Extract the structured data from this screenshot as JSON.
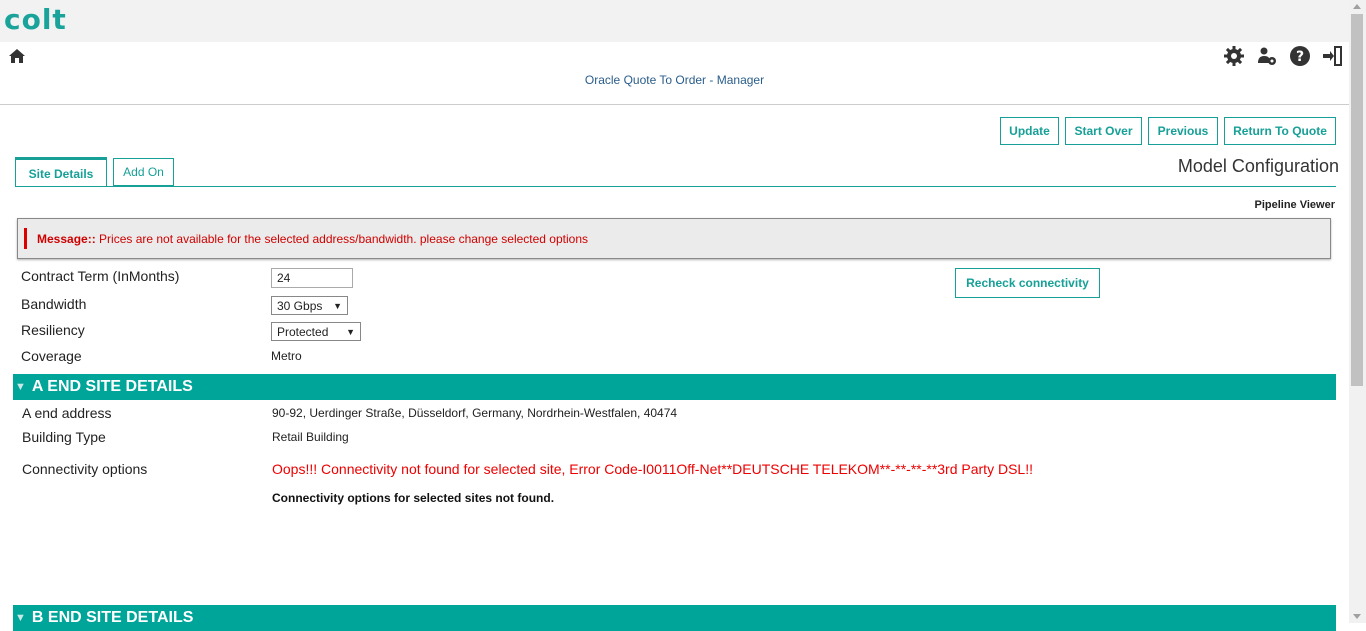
{
  "header": {
    "logo": "colt",
    "app_title": "Oracle Quote To Order - Manager",
    "icons": [
      "home-icon",
      "settings-gear-icon",
      "user-settings-icon",
      "help-icon",
      "logout-icon"
    ]
  },
  "toolbar": {
    "update": "Update",
    "start_over": "Start Over",
    "previous": "Previous",
    "return_to_quote": "Return To Quote"
  },
  "tabs": [
    {
      "label": "Site Details",
      "active": true
    },
    {
      "label": "Add On",
      "active": false
    }
  ],
  "model_config_title": "Model Configuration",
  "pipeline_viewer": "Pipeline Viewer",
  "message": {
    "prefix": "Message::",
    "text": " Prices are not available for the selected address/bandwidth. please change selected options"
  },
  "form": {
    "contract_term": {
      "label": "Contract Term (InMonths)",
      "value": "24"
    },
    "bandwidth": {
      "label": "Bandwidth",
      "value": "30 Gbps"
    },
    "resiliency": {
      "label": "Resiliency",
      "value": "Protected"
    },
    "coverage": {
      "label": "Coverage",
      "value": "Metro"
    },
    "recheck_button": "Recheck connectivity"
  },
  "a_end": {
    "section_title": "A END SITE DETAILS",
    "address_label": "A end address",
    "address_value": "90-92, Uerdinger Straße, Düsseldorf, Germany, Nordrhein-Westfalen, 40474",
    "building_type_label": "Building Type",
    "building_type_value": "Retail Building",
    "connectivity_label": "Connectivity options",
    "connectivity_error": "Oops!!! Connectivity not found for selected site, Error Code-I0011Off-Net**DEUTSCHE TELEKOM**-**-**-**3rd Party DSL!!",
    "connectivity_note": "Connectivity options for selected sites not found."
  },
  "b_end": {
    "section_title": "B END SITE DETAILS"
  },
  "colors": {
    "accent": "#17a097",
    "section_bar": "#00a59a",
    "error": "#ee0000",
    "link": "#2a5d8a"
  }
}
